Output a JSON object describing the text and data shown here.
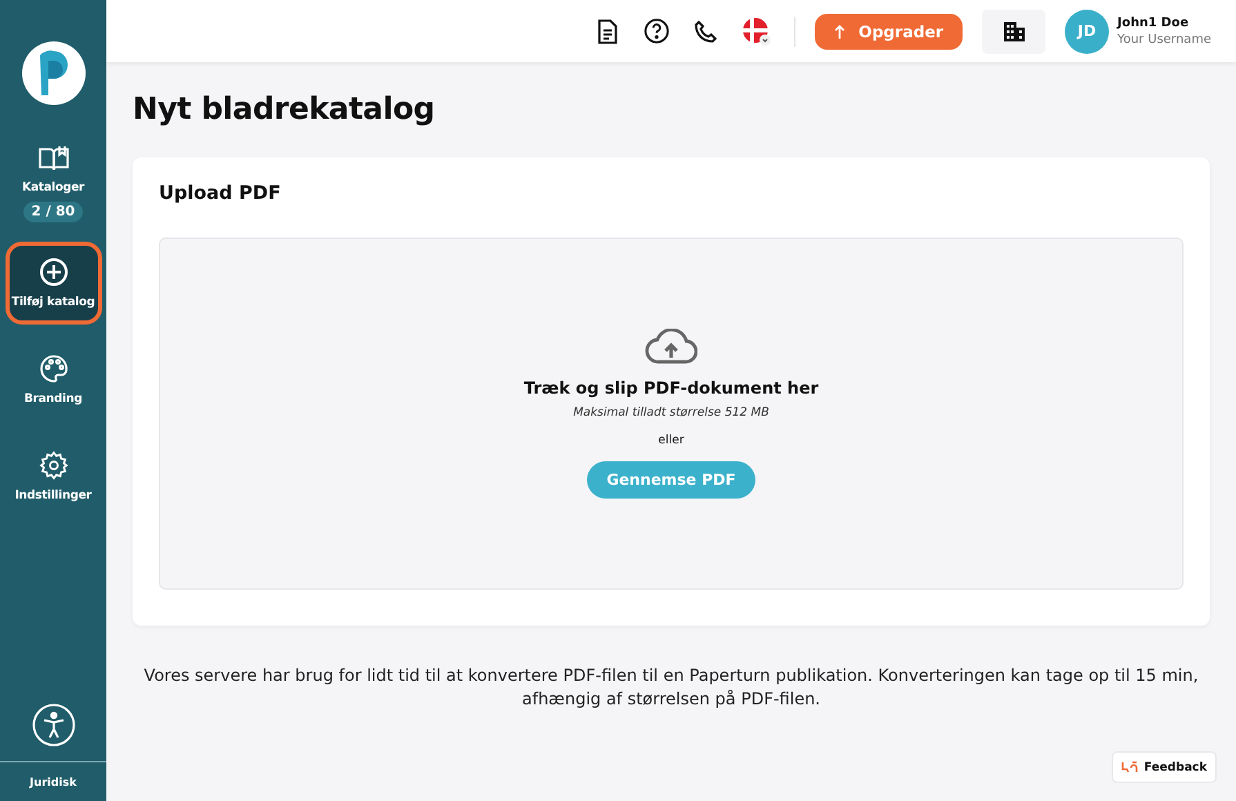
{
  "sidebar": {
    "items": [
      {
        "kind": "book",
        "label": "Kataloger",
        "badge": "2 / 80",
        "selected": false
      },
      {
        "kind": "plus",
        "label": "Tilføj katalog",
        "selected": true
      },
      {
        "kind": "palette",
        "label": "Branding",
        "selected": false
      },
      {
        "kind": "gear",
        "label": "Indstillinger",
        "selected": false
      }
    ],
    "footer_link": "Juridisk"
  },
  "topbar": {
    "upgrade_button": "Opgrader",
    "user": {
      "initials": "JD",
      "name": "John1 Doe",
      "username": "Your Username"
    }
  },
  "page": {
    "title": "Nyt bladrekatalog",
    "card": {
      "title": "Upload PDF",
      "dropzone": {
        "heading": "Træk og slip PDF-dokument her",
        "limit": "Maksimal tilladt størrelse 512 MB",
        "separator": "eller",
        "button": "Gennemse PDF"
      }
    },
    "note": "Vores servere har brug for lidt tid til at konvertere PDF-filen til en Paperturn publikation. Konverteringen kan tage op til 15 min, afhængig af størrelsen på PDF-filen.",
    "feedback_button": "Feedback"
  }
}
